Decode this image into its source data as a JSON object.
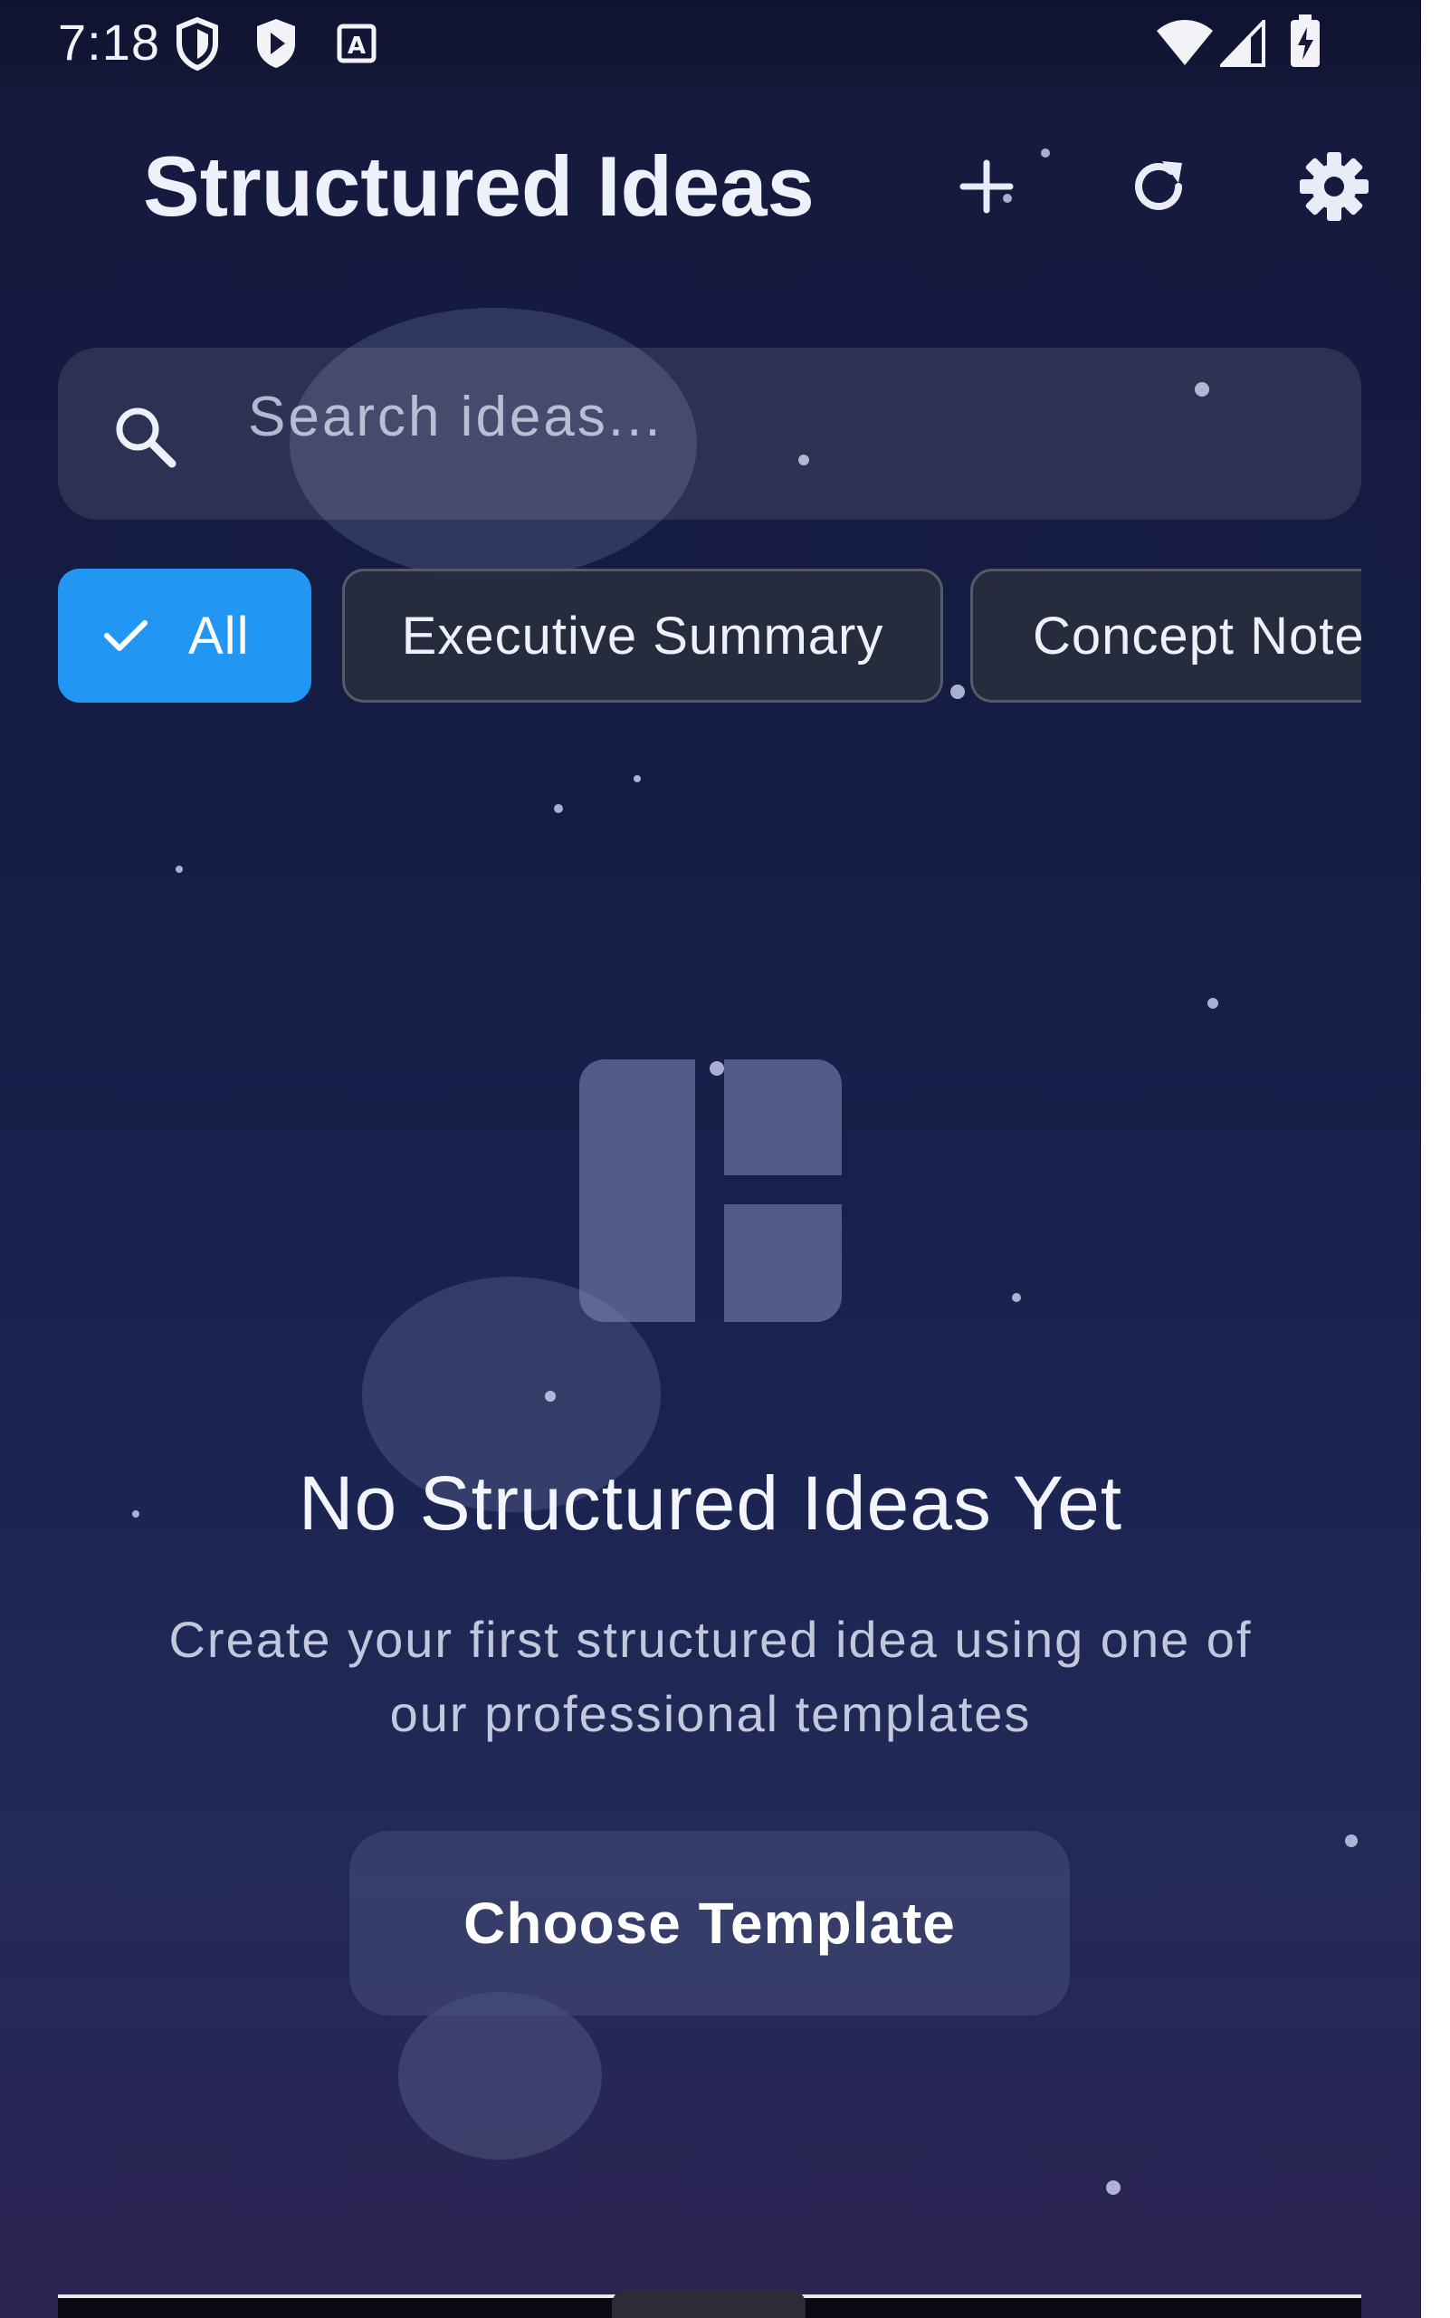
{
  "status_bar": {
    "time": "7:18",
    "left_icons": [
      "shield-outline-icon",
      "play-shield-icon",
      "a-square-icon"
    ],
    "right_icons": [
      "wifi-icon",
      "cell-signal-icon",
      "battery-charging-icon"
    ]
  },
  "header": {
    "title": "Structured Ideas",
    "actions": [
      "add-icon",
      "refresh-icon",
      "settings-icon"
    ]
  },
  "search": {
    "placeholder": "Search ideas...",
    "value": ""
  },
  "filters": {
    "chips": [
      {
        "label": "All",
        "selected": true
      },
      {
        "label": "Executive Summary",
        "selected": false
      },
      {
        "label": "Concept Note",
        "selected": false
      }
    ]
  },
  "empty_state": {
    "icon": "dashboard-layout-icon",
    "title": "No Structured Ideas Yet",
    "subtitle_line1": "Create your first structured idea using one of",
    "subtitle_line2": "our professional templates",
    "button_label": "Choose Template"
  },
  "theme": {
    "accent": "#2196f3",
    "background_top": "#151a3d",
    "background_bottom": "#2c2352"
  }
}
